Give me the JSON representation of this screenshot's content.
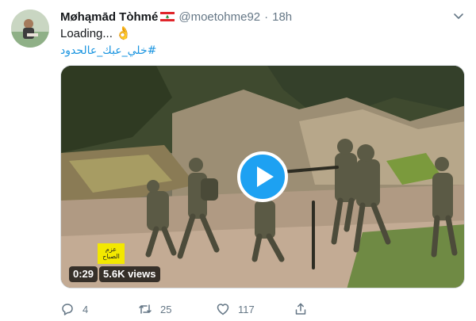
{
  "tweet": {
    "display_name": "Møhąmād Tòhmé",
    "handle": "@moetohme92",
    "separator": "·",
    "time": "18h",
    "text_line1": "Loading...",
    "emoji": "👌",
    "hashtag": "#خلي_عبك_عالحدود"
  },
  "media": {
    "duration": "0:29",
    "views": "5.6K views",
    "watermark_line1": "عزم",
    "watermark_line2": "الصباح",
    "play_icon": "play-icon"
  },
  "actions": {
    "reply_count": "4",
    "retweet_count": "25",
    "like_count": "117"
  },
  "colors": {
    "accent": "#1da1f2",
    "link": "#1b95e0",
    "muted": "#657786"
  }
}
